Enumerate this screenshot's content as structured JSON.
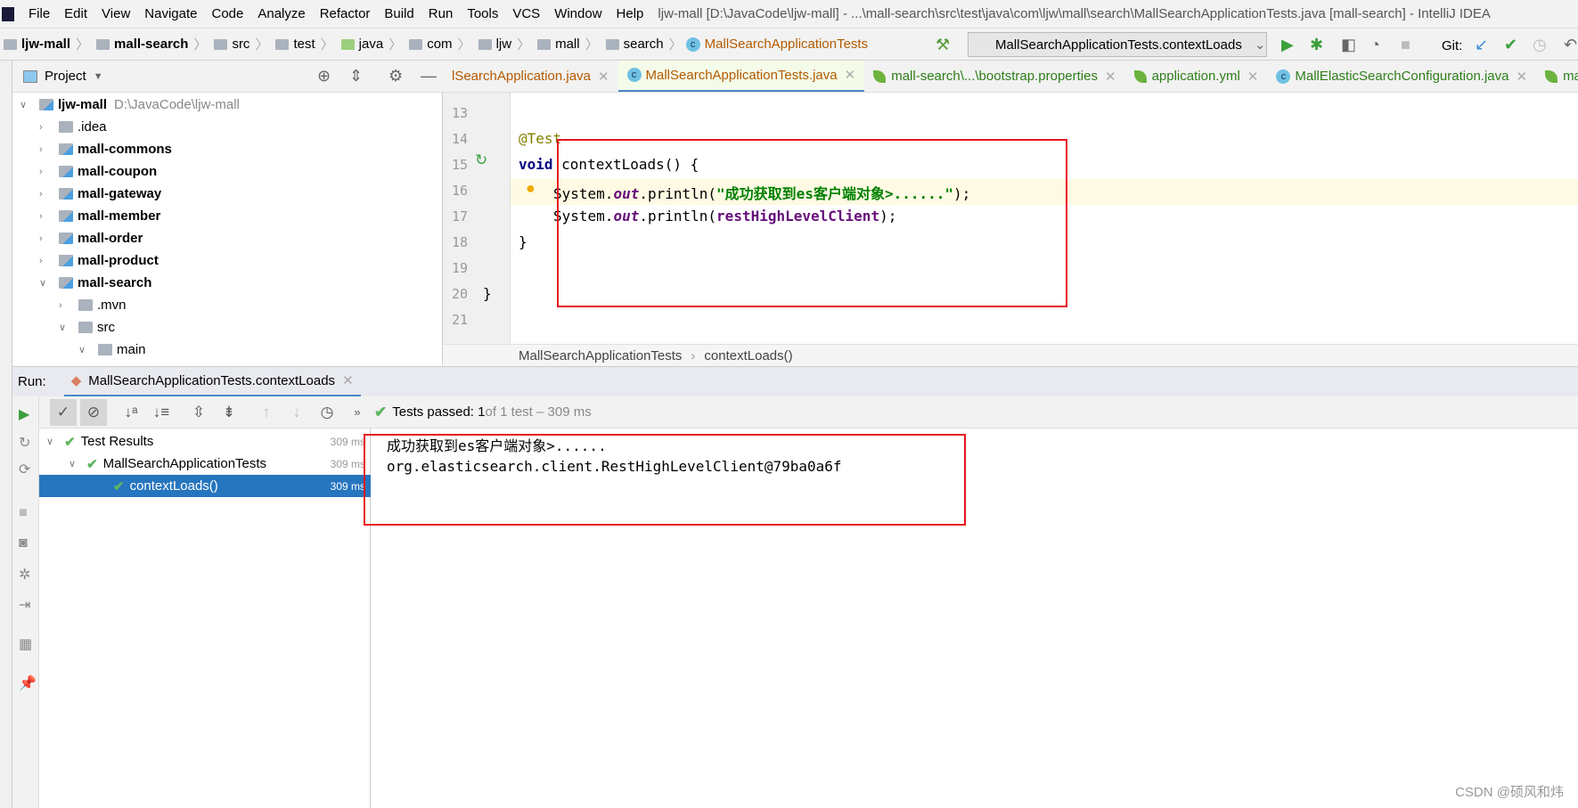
{
  "menu": {
    "items": [
      "File",
      "Edit",
      "View",
      "Navigate",
      "Code",
      "Analyze",
      "Refactor",
      "Build",
      "Run",
      "Tools",
      "VCS",
      "Window",
      "Help"
    ],
    "title": "ljw-mall [D:\\JavaCode\\ljw-mall] - ...\\mall-search\\src\\test\\java\\com\\ljw\\mall\\search\\MallSearchApplicationTests.java [mall-search] - IntelliJ IDEA"
  },
  "breadcrumb": [
    "ljw-mall",
    "mall-search",
    "src",
    "test",
    "java",
    "com",
    "ljw",
    "mall",
    "search",
    "MallSearchApplicationTests"
  ],
  "toolbar": {
    "run_config": "MallSearchApplicationTests.contextLoads",
    "git_label": "Git:"
  },
  "project": {
    "title": "Project",
    "root": {
      "name": "ljw-mall",
      "path": "D:\\JavaCode\\ljw-mall"
    },
    "items": [
      {
        "name": ".idea",
        "bold": false,
        "depth": 1,
        "open": false
      },
      {
        "name": "mall-commons",
        "bold": true,
        "depth": 1,
        "open": false
      },
      {
        "name": "mall-coupon",
        "bold": true,
        "depth": 1,
        "open": false
      },
      {
        "name": "mall-gateway",
        "bold": true,
        "depth": 1,
        "open": false
      },
      {
        "name": "mall-member",
        "bold": true,
        "depth": 1,
        "open": false
      },
      {
        "name": "mall-order",
        "bold": true,
        "depth": 1,
        "open": false
      },
      {
        "name": "mall-product",
        "bold": true,
        "depth": 1,
        "open": false
      },
      {
        "name": "mall-search",
        "bold": true,
        "depth": 1,
        "open": true
      },
      {
        "name": ".mvn",
        "bold": false,
        "depth": 2,
        "open": false
      },
      {
        "name": "src",
        "bold": false,
        "depth": 2,
        "open": true
      },
      {
        "name": "main",
        "bold": false,
        "depth": 3,
        "open": true
      }
    ]
  },
  "tabs": [
    {
      "label": "lSearchApplication.java",
      "color": "#b35a00"
    },
    {
      "label": "MallSearchApplicationTests.java",
      "color": "#b35a00",
      "active": true
    },
    {
      "label": "mall-search\\...\\bootstrap.properties",
      "color": "#2e7d1a"
    },
    {
      "label": "application.yml",
      "color": "#2e7d1a"
    },
    {
      "label": "MallElasticSearchConfiguration.java",
      "color": "#2e7d1a"
    },
    {
      "label": "mal",
      "color": "#2e7d1a"
    }
  ],
  "editor": {
    "line_numbers": [
      "13",
      "14",
      "15",
      "16",
      "17",
      "18",
      "19",
      "20",
      "21"
    ],
    "annotation": "@Test",
    "kw_void": "void",
    "method_sig": " contextLoads() {",
    "l16_a": "System.",
    "l16_out": "out",
    "l16_b": ".println(",
    "l16_str": "\"成功获取到es客户端对象>......\"",
    "l16_c": ");",
    "l17_a": "System.",
    "l17_out": "out",
    "l17_b": ".println(",
    "l17_field": "restHighLevelClient",
    "l17_c": ");",
    "close_method": "}",
    "close_class": "}",
    "crumb": [
      "MallSearchApplicationTests",
      "contextLoads()"
    ]
  },
  "run": {
    "label": "Run:",
    "tab": "MallSearchApplicationTests.contextLoads",
    "status_bold": "Tests passed: 1",
    "status_rest": " of 1 test – 309 ms",
    "tree": [
      {
        "name": "Test Results",
        "time": "309 ms"
      },
      {
        "name": "MallSearchApplicationTests",
        "time": "309 ms"
      },
      {
        "name": "contextLoads()",
        "time": "309 ms",
        "selected": true
      }
    ],
    "console": [
      "成功获取到es客户端对象>......",
      "org.elasticsearch.client.RestHighLevelClient@79ba0a6f"
    ]
  },
  "watermark": "CSDN @硕风和炜",
  "colors": {
    "highlight_box": "#e8141f",
    "selection": "#2675bf",
    "pass": "#5fb55f"
  }
}
